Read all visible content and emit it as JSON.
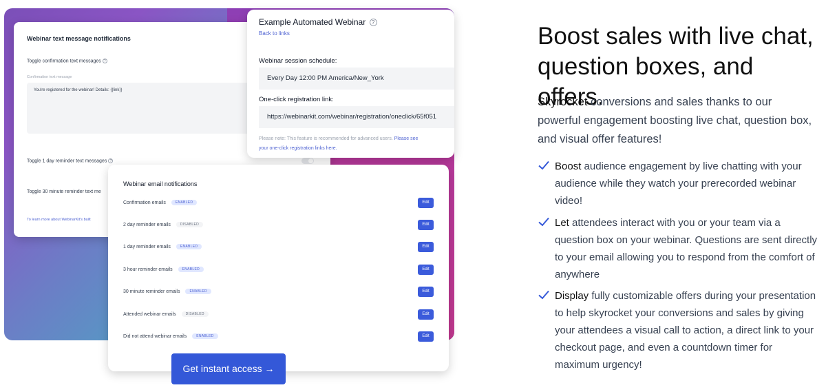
{
  "sms_panel": {
    "title": "Webinar text message notifications",
    "toggle_confirmation": "Toggle confirmation text messages",
    "confirmation_label": "Confirmation text message",
    "confirmation_message": "You're registered for the webinar! Details: {{link}}",
    "toggle_1day": "Toggle 1 day reminder text messages",
    "toggle_30min": "Toggle 30 minute reminder text me",
    "learn_more": "To learn more about WebinarKit's built"
  },
  "details_panel": {
    "title": "Example Automated Webinar",
    "back_link": "Back to links",
    "schedule_label": "Webinar session schedule:",
    "schedule_value": "Every Day 12:00 PM America/New_York",
    "registration_label": "One-click registration link:",
    "registration_value": "https://webinarkit.com/webinar/registration/oneclick/65f051",
    "note_text": "Please note: This feature is recommended for advanced users.",
    "note_link_1": "Please see",
    "note_link_2": "your one-click registration links here."
  },
  "email_panel": {
    "title": "Webinar email notifications",
    "edit_label": "Edit",
    "rows": [
      {
        "name": "Confirmation emails",
        "status": "ENABLED"
      },
      {
        "name": "2 day reminder emails",
        "status": "DISABLED"
      },
      {
        "name": "1 day reminder emails",
        "status": "ENABLED"
      },
      {
        "name": "3 hour reminder emails",
        "status": "ENABLED"
      },
      {
        "name": "30 minute reminder emails",
        "status": "ENABLED"
      },
      {
        "name": "Attended webinar emails",
        "status": "DISABLED"
      },
      {
        "name": "Did not attend webinar emails",
        "status": "ENABLED"
      }
    ]
  },
  "cta": {
    "label": "Get instant access →"
  },
  "content": {
    "headline": "Boost sales with live chat, question boxes, and offers.",
    "intro_strong": "Skyrocket",
    "intro_rest": " conversions and sales thanks to our powerful engagement boosting live chat, question box, and visual offer features!",
    "features": [
      {
        "strong": "Boost",
        "rest": " audience engagement by live chatting with your audience while they watch your prerecorded webinar video!"
      },
      {
        "strong": "Let",
        "rest": " attendees interact with you or your team via a question box on your webinar. Questions are sent directly to your email allowing you to respond from the comfort of anywhere"
      },
      {
        "strong": "Display",
        "rest": " fully customizable offers during your presentation to help skyrocket your conversions and sales by giving your attendees a visual call to action, a direct link to your checkout page, and even a countdown timer for maximum urgency!"
      }
    ]
  },
  "icons": {
    "check": "check-icon",
    "help": "question-circle-icon"
  },
  "colors": {
    "accent": "#3458d8",
    "check": "#3458d8",
    "enabled_badge": "#e0e7ff"
  }
}
